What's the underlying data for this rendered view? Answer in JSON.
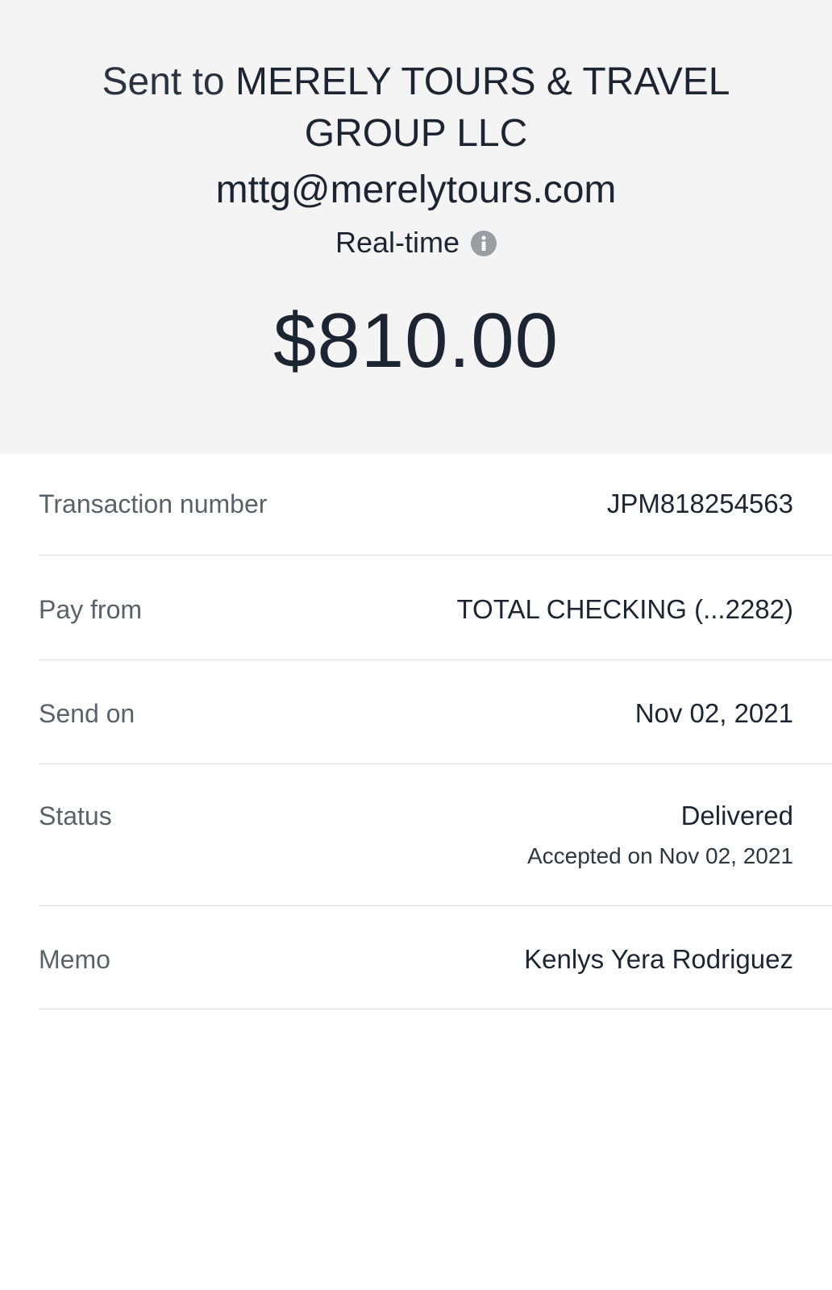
{
  "header": {
    "sent_to_prefix": "Sent to",
    "recipient_name": "MERELY TOURS & TRAVEL GROUP LLC",
    "recipient_email": "mttg@merelytours.com",
    "delivery_speed": "Real-time",
    "info_icon": "info-circle-icon",
    "amount": "$810.00"
  },
  "details": {
    "transaction_number": {
      "label": "Transaction number",
      "value": "JPM818254563"
    },
    "pay_from": {
      "label": "Pay from",
      "value": "TOTAL CHECKING (...2282)"
    },
    "send_on": {
      "label": "Send on",
      "value": "Nov 02, 2021"
    },
    "status": {
      "label": "Status",
      "value": "Delivered",
      "subvalue": "Accepted on Nov 02, 2021"
    },
    "memo": {
      "label": "Memo",
      "value": "Kenlys Yera Rodriguez"
    }
  },
  "colors": {
    "header_background": "#f4f4f5",
    "text_primary": "#1c2532",
    "text_label": "#5b6169",
    "divider": "#d9dbde",
    "info_icon": "#9a9ea3"
  }
}
